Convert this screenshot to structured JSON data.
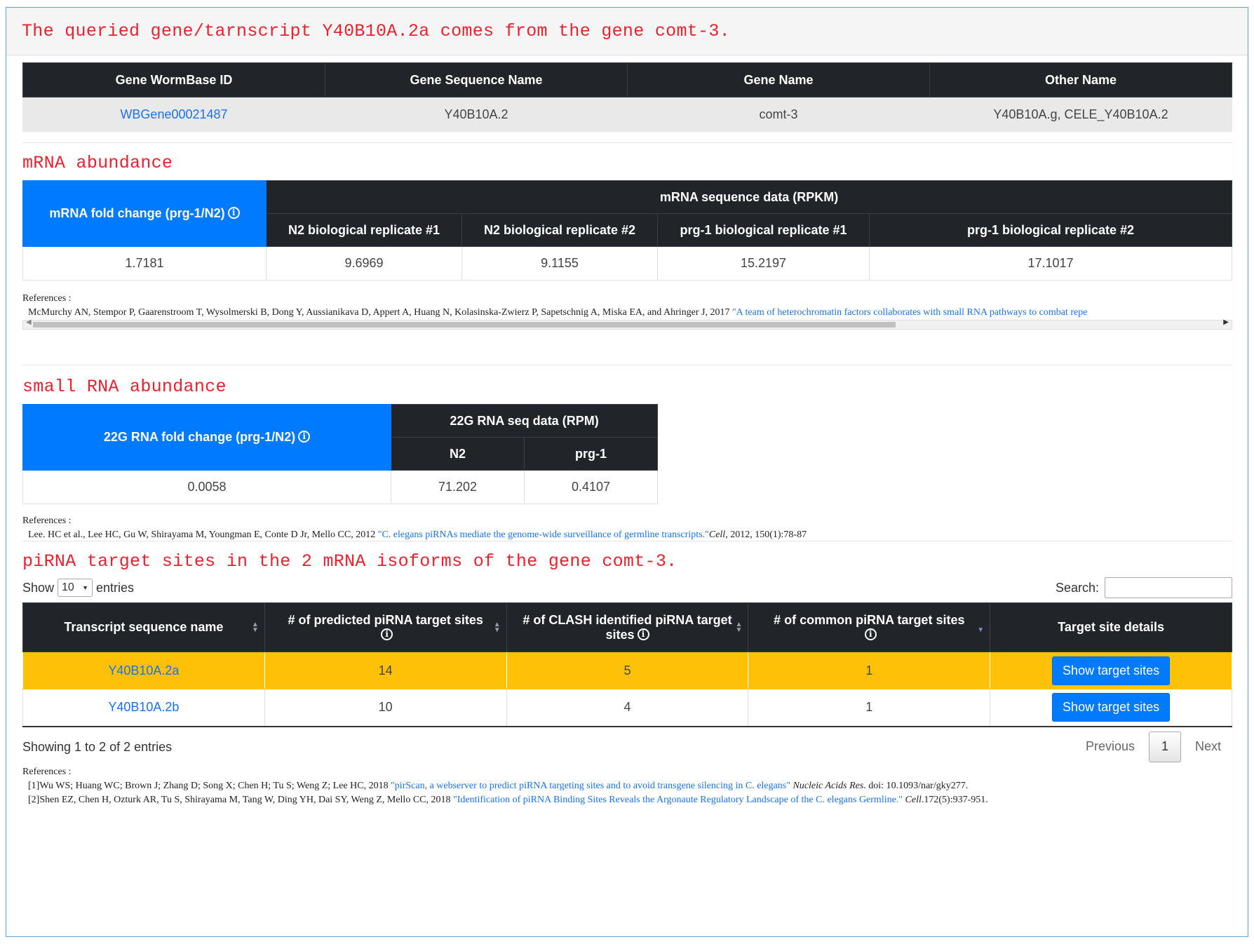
{
  "header": {
    "title": "The queried gene/tarnscript Y40B10A.2a comes from the gene comt-3."
  },
  "gene_table": {
    "headers": [
      "Gene WormBase ID",
      "Gene Sequence Name",
      "Gene Name",
      "Other Name"
    ],
    "row": {
      "wormbase_id": "WBGene00021487",
      "sequence_name": "Y40B10A.2",
      "gene_name": "comt-3",
      "other_name": "Y40B10A.g, CELE_Y40B10A.2"
    }
  },
  "mrna": {
    "title": "mRNA abundance",
    "fold_header": "mRNA fold change (prg-1/N2)",
    "group_header": "mRNA sequence data (RPKM)",
    "sub_headers": [
      "N2 biological replicate #1",
      "N2 biological replicate #2",
      "prg-1 biological replicate #1",
      "prg-1 biological replicate #2"
    ],
    "values": [
      "1.7181",
      "9.6969",
      "9.1155",
      "15.2197",
      "17.1017"
    ],
    "refs_label": "References :",
    "ref_authors": "McMurchy AN, Stempor P, Gaarenstroom T, Wysolmerski B, Dong Y, Aussianikava D, Appert A, Huang N, Kolasinska-Zwierz P, Sapetschnig A, Miska EA, and Ahringer J, 2017",
    "ref_link": "\"A team of heterochromatin factors collaborates with small RNA pathways to combat repe"
  },
  "small_rna": {
    "title": "small RNA abundance",
    "fold_header": "22G RNA fold change (prg-1/N2)",
    "group_header": "22G RNA seq data (RPM)",
    "sub_headers": [
      "N2",
      "prg-1"
    ],
    "values": [
      "0.0058",
      "71.202",
      "0.4107"
    ],
    "refs_label": "References :",
    "ref_authors": "Lee. HC et al., Lee HC, Gu W, Shirayama M, Youngman E, Conte D Jr, Mello CC, 2012",
    "ref_link": "\"C. elegans piRNAs mediate the genome-wide surveillance of germline transcripts.\"",
    "ref_journal": "Cell",
    "ref_tail": ", 2012, 150(1):78-87"
  },
  "pirna": {
    "title": "piRNA target sites in the 2 mRNA isoforms of the gene comt-3.",
    "show_label": "Show",
    "entries_value": "10",
    "entries_label": "entries",
    "search_label": "Search:",
    "headers": [
      "Transcript sequence name",
      "# of predicted piRNA target sites",
      "# of CLASH identified piRNA target sites",
      "# of common piRNA target sites",
      "Target site details"
    ],
    "rows": [
      {
        "name": "Y40B10A.2a",
        "predicted": "14",
        "clash": "5",
        "common": "1",
        "button": "Show target sites"
      },
      {
        "name": "Y40B10A.2b",
        "predicted": "10",
        "clash": "4",
        "common": "1",
        "button": "Show target sites"
      }
    ],
    "info": "Showing 1 to 2 of 2 entries",
    "prev": "Previous",
    "page": "1",
    "next": "Next",
    "refs_label": "References :",
    "ref1_authors": "[1]Wu WS; Huang WC; Brown J; Zhang D; Song X; Chen H; Tu S; Weng Z; Lee HC, 2018",
    "ref1_link": "\"pirScan, a webserver to predict piRNA targeting sites and to avoid transgene silencing in C. elegans\"",
    "ref1_journal": "Nucleic Acids Res",
    "ref1_tail": ". doi: 10.1093/nar/gky277.",
    "ref2_authors": "[2]Shen EZ, Chen H, Ozturk AR, Tu S, Shirayama M, Tang W, Ding YH, Dai SY, Weng Z, Mello CC, 2018",
    "ref2_link": "\"Identification of piRNA Binding Sites Reveals the Argonaute Regulatory Landscape of the C. elegans Germline.\"",
    "ref2_journal": "Cell",
    "ref2_tail": ".172(5):937-951."
  },
  "colors": {
    "accent_blue": "#007bff",
    "header_dark": "#212529",
    "title_red": "#e8232f",
    "highlight_row": "#ffc107",
    "link": "#1a73e8"
  },
  "icons": {
    "info": "info-circle-icon",
    "sort": "sort-arrows-icon",
    "scroll_left": "arrow-left-icon",
    "scroll_right": "arrow-right-icon"
  }
}
